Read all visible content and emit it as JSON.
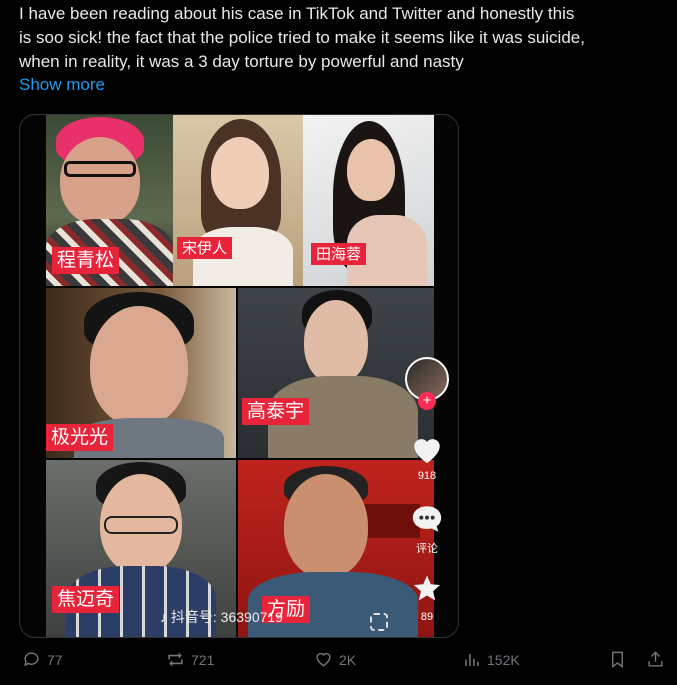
{
  "post": {
    "text_lines": [
      "I have been reading about his case in TikTok and Twitter and honestly this",
      "is soo sick! the fact that the police tried to make it seems like it was suicide,",
      "when in reality,  it was a 3 day torture by powerful and nasty"
    ],
    "show_more": "Show more"
  },
  "media": {
    "name_tags": [
      "程青松",
      "宋伊人",
      "田海蓉",
      "极光光",
      "高泰宇",
      "焦迈奇",
      "方励"
    ],
    "like_count": "918",
    "comment_label": "评论",
    "share_count": "89",
    "watermark": "抖音号: 36390719"
  },
  "actions": {
    "replies": "77",
    "reposts": "721",
    "likes": "2K",
    "views": "152K"
  },
  "colors": {
    "background": "#000000",
    "text": "#e7e9ea",
    "link": "#1d9bf0",
    "muted": "#71767b",
    "tag_red": "#e8243a"
  }
}
